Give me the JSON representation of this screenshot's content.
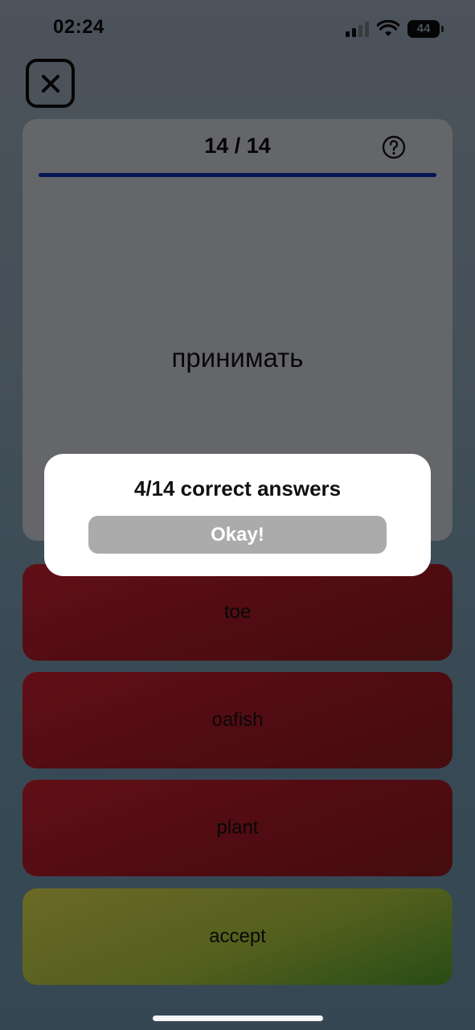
{
  "status_bar": {
    "time": "02:24",
    "battery": "44",
    "icons": [
      "cellular-signal-icon",
      "wifi-icon",
      "battery-icon"
    ]
  },
  "header": {
    "close_icon": "close-icon"
  },
  "card": {
    "counter": "14 / 14",
    "help_icon": "question-mark-icon",
    "progress": 1.0,
    "word": "принимать"
  },
  "answers": [
    {
      "label": "toe",
      "state": "wrong"
    },
    {
      "label": "oafish",
      "state": "wrong"
    },
    {
      "label": "plant",
      "state": "wrong"
    },
    {
      "label": "accept",
      "state": "correct"
    }
  ],
  "dialog": {
    "title": "4/14 correct answers",
    "button_label": "Okay!"
  },
  "colors": {
    "accent_progress": "#0b2aa8",
    "wrong": "#a01824",
    "correct": "#a9bf3c",
    "dialog_button": "#ababab"
  }
}
